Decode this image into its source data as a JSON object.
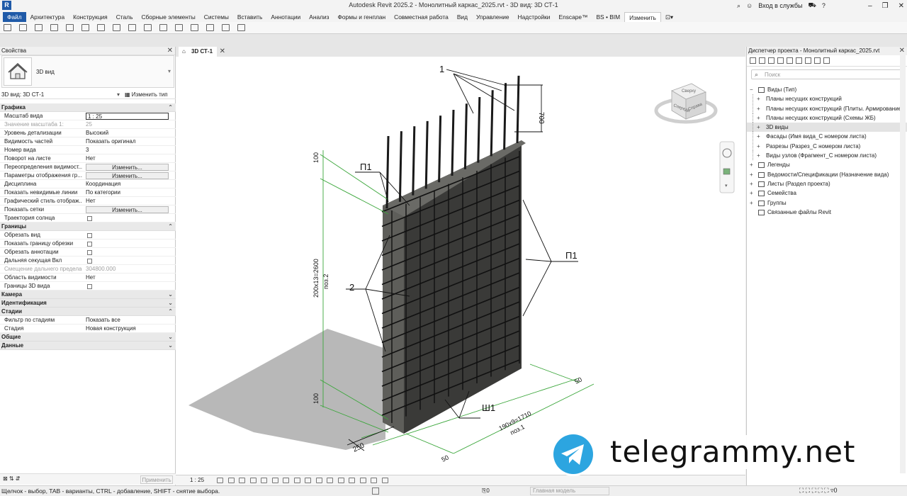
{
  "titlebar": {
    "title": "Autodesk Revit 2025.2 - Монолитный каркас_2025.rvt - 3D вид: 3D СТ-1",
    "app_logo": "R",
    "signin": "Вход в службы",
    "help": "?"
  },
  "ribbon": {
    "tabs": [
      "Файл",
      "Архитектура",
      "Конструкция",
      "Сталь",
      "Сборные элементы",
      "Системы",
      "Вставить",
      "Аннотации",
      "Анализ",
      "Формы и генплан",
      "Совместная работа",
      "Вид",
      "Управление",
      "Надстройки",
      "Enscape™",
      "BS • BIM",
      "Изменить"
    ],
    "active_tab": "Изменить"
  },
  "properties": {
    "header": "Свойства",
    "type_name": "3D вид",
    "instance_selector": "3D вид: 3D СТ-1",
    "edit_type": "Изменить тип",
    "apply": "Применить",
    "groups": [
      {
        "name": "Графика",
        "rows": [
          {
            "name": "Масштаб вида",
            "value": "1 : 25",
            "kind": "input"
          },
          {
            "name": "Значение масштаба    1:",
            "value": "25",
            "kind": "dim"
          },
          {
            "name": "Уровень детализации",
            "value": "Высокий"
          },
          {
            "name": "Видимость частей",
            "value": "Показать оригинал"
          },
          {
            "name": "Номер вида",
            "value": "3"
          },
          {
            "name": "Поворот на листе",
            "value": "Нет"
          },
          {
            "name": "Переопределения видимост...",
            "value": "Изменить...",
            "kind": "button"
          },
          {
            "name": "Параметры отображения гр...",
            "value": "Изменить...",
            "kind": "button"
          },
          {
            "name": "Дисциплина",
            "value": "Координация"
          },
          {
            "name": "Показать невидимые линии",
            "value": "По категории"
          },
          {
            "name": "Графический стиль отображ...",
            "value": "Нет"
          },
          {
            "name": "Показать сетки",
            "value": "Изменить...",
            "kind": "button"
          },
          {
            "name": "Траектория солнца",
            "value": "",
            "kind": "check"
          }
        ]
      },
      {
        "name": "Границы",
        "rows": [
          {
            "name": "Обрезать вид",
            "value": "",
            "kind": "check"
          },
          {
            "name": "Показать границу обрезки",
            "value": "",
            "kind": "check"
          },
          {
            "name": "Обрезать аннотации",
            "value": "",
            "kind": "check"
          },
          {
            "name": "Дальняя секущая Вкл",
            "value": "",
            "kind": "check"
          },
          {
            "name": "Смещение дальнего предела...",
            "value": "304800.000",
            "kind": "dim"
          },
          {
            "name": "Область видимости",
            "value": "Нет"
          },
          {
            "name": "Границы 3D вида",
            "value": "",
            "kind": "check"
          }
        ]
      },
      {
        "name": "Камера",
        "rows": []
      },
      {
        "name": "Идентификация",
        "rows": []
      },
      {
        "name": "Стадии",
        "rows": [
          {
            "name": "Фильтр по стадиям",
            "value": "Показать все"
          },
          {
            "name": "Стадия",
            "value": "Новая конструкция"
          }
        ]
      },
      {
        "name": "Общие",
        "rows": []
      },
      {
        "name": "Данные",
        "rows": []
      }
    ]
  },
  "view": {
    "tab": "3D СТ-1",
    "scale": "1 : 25",
    "viewcube": {
      "top": "Сверху",
      "left": "Спереди",
      "right": "Справа"
    },
    "labels": {
      "mark_1": "1",
      "mark_2": "2",
      "mark_p1_top": "П1",
      "mark_p1_right": "П1",
      "mark_sh1": "Ш1",
      "dim_700": "700",
      "dim_100_top": "100",
      "dim_100_bottom": "100",
      "dim_height": "200х13=2600",
      "pos_2": "поз.2",
      "dim_length": "190х9=1710",
      "pos_1": "поз.1",
      "dim_50_a": "50",
      "dim_50_b": "50",
      "dim_250": "250"
    }
  },
  "browser": {
    "header": "Диспетчер проекта - Монолитный каркас_2025.rvt",
    "search_placeholder": "Поиск",
    "nodes": [
      {
        "level": 0,
        "toggle": "−",
        "label": "Виды (Тип)"
      },
      {
        "level": 1,
        "toggle": "+",
        "label": "Планы несущих конструкций"
      },
      {
        "level": 1,
        "toggle": "+",
        "label": "Планы несущих конструкций (Плиты. Армирование)"
      },
      {
        "level": 1,
        "toggle": "+",
        "label": "Планы несущих конструкций (Схемы ЖБ)"
      },
      {
        "level": 1,
        "toggle": "+",
        "label": "3D виды",
        "selected": true
      },
      {
        "level": 1,
        "toggle": "+",
        "label": "Фасады (Имя вида_С номером листа)"
      },
      {
        "level": 1,
        "toggle": "+",
        "label": "Разрезы (Разрез_С номером листа)"
      },
      {
        "level": 1,
        "toggle": "+",
        "label": "Виды узлов (Фрагмент_С номером листа)"
      },
      {
        "level": 0,
        "toggle": "+",
        "label": "Легенды"
      },
      {
        "level": 0,
        "toggle": "+",
        "label": "Ведомости/Спецификации (Назначение вида)"
      },
      {
        "level": 0,
        "toggle": "+",
        "label": "Листы (Раздел проекта)"
      },
      {
        "level": 0,
        "toggle": "+",
        "label": "Семейства"
      },
      {
        "level": 0,
        "toggle": "+",
        "label": "Группы"
      },
      {
        "level": 0,
        "toggle": "",
        "label": "Связанные файлы Revit"
      }
    ]
  },
  "statusbar": {
    "text": "Щелчок - выбор, TAB - варианты, CTRL - добавление, SHIFT - снятие выбора.",
    "model": "Главная модель",
    "count": "0"
  },
  "watermark": {
    "text": "telegrammy.net"
  }
}
